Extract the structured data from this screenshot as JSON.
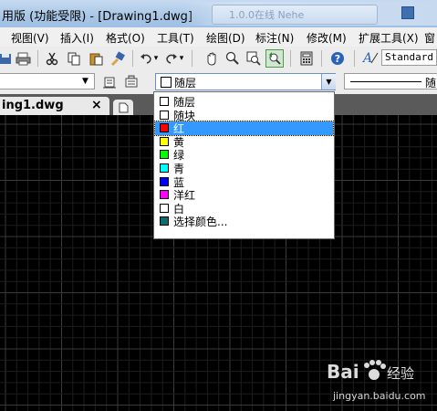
{
  "window": {
    "title": "用版 (功能受限) - [Drawing1.dwg]",
    "search_hint": "1.0.0在线 Nehe"
  },
  "menu": [
    {
      "label": "视图(V)"
    },
    {
      "label": "插入(I)"
    },
    {
      "label": "格式(O)"
    },
    {
      "label": "工具(T)"
    },
    {
      "label": "绘图(D)"
    },
    {
      "label": "标注(N)"
    },
    {
      "label": "修改(M)"
    },
    {
      "label": "扩展工具(X)"
    },
    {
      "label": "窗"
    }
  ],
  "toolbar": {
    "text_style": "Standard"
  },
  "properties": {
    "layer_value": "",
    "color_value": "随层",
    "linetype_value": "随"
  },
  "document_tab": {
    "label": "ing1.dwg",
    "close": "×"
  },
  "color_dropdown": {
    "options": [
      {
        "label": "随层",
        "color": "#ffffff",
        "selected": false
      },
      {
        "label": "随块",
        "color": "#ffffff",
        "selected": false
      },
      {
        "label": "红",
        "color": "#ff0000",
        "selected": true
      },
      {
        "label": "黄",
        "color": "#ffff00",
        "selected": false
      },
      {
        "label": "绿",
        "color": "#00ff00",
        "selected": false
      },
      {
        "label": "青",
        "color": "#00ffff",
        "selected": false
      },
      {
        "label": "蓝",
        "color": "#0000ff",
        "selected": false
      },
      {
        "label": "洋红",
        "color": "#ff00ff",
        "selected": false
      },
      {
        "label": "白",
        "color": "#ffffff",
        "selected": false
      },
      {
        "label": "选择颜色...",
        "color": "#0f6b72",
        "selected": false
      }
    ]
  },
  "watermark": {
    "brand": "Bai 经验",
    "url": "jingyan.baidu.com"
  }
}
